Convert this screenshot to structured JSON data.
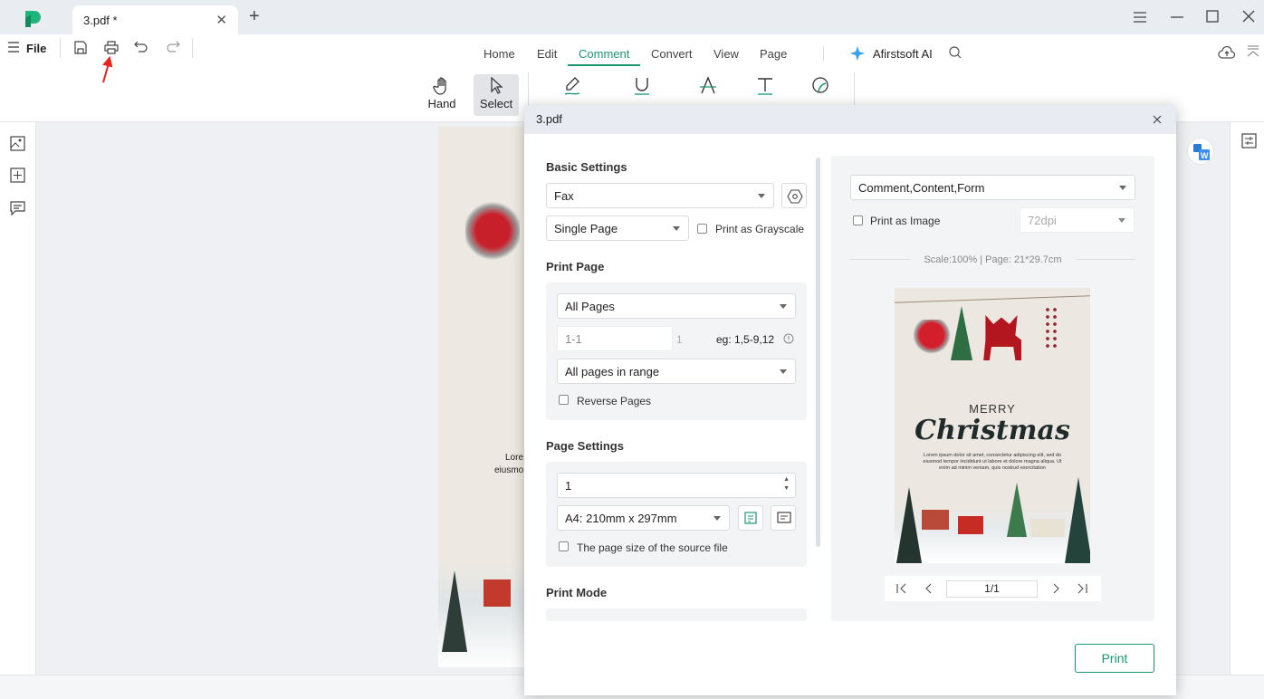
{
  "app": {
    "tab_title": "3.pdf *",
    "file_label": "File"
  },
  "menu": {
    "tabs": [
      "Home",
      "Edit",
      "Comment",
      "Convert",
      "View",
      "Page"
    ],
    "active": "Comment",
    "ai_label": "Afirstsoft AI"
  },
  "tools": [
    {
      "label": "Hand",
      "icon": "hand-icon"
    },
    {
      "label": "Select",
      "icon": "cursor-icon"
    }
  ],
  "colors": {
    "accent": "#1a9a6c",
    "annotation_arrow": "#e8231b"
  },
  "document": {
    "text_fragments": [
      "Lore",
      "eiusmo"
    ]
  },
  "dialog": {
    "title": "3.pdf",
    "basic_settings": {
      "heading": "Basic Settings",
      "printer": "Fax",
      "layout": "Single Page",
      "grayscale_label": "Print as Grayscale",
      "grayscale_checked": false
    },
    "print_page": {
      "heading": "Print Page",
      "range_mode": "All Pages",
      "range_placeholder": "1-1",
      "total": "1",
      "example": "eg: 1,5-9,12",
      "subset": "All pages in range",
      "reverse_label": "Reverse Pages",
      "reverse_checked": false
    },
    "page_settings": {
      "heading": "Page Settings",
      "copies": "1",
      "paper": "A4: 210mm x 297mm",
      "source_size_label": "The page size of the source file",
      "source_size_checked": false
    },
    "print_mode": {
      "heading": "Print Mode"
    },
    "preview": {
      "content": "Comment,Content,Form",
      "image_label": "Print as Image",
      "image_checked": false,
      "dpi": "72dpi",
      "info": "Scale:100% | Page: 21*29.7cm",
      "page_value": "1/1",
      "card": {
        "line1": "MERRY",
        "line2": "Christmas",
        "body": "Lorem ipsum dolor sit amet, consectetur adipiscing elit, sed do eiusmod tempor incididunt ut labore et dolore magna aliqua. Ut enim ad minim veniam, quis nostrud exercitation"
      }
    },
    "print_label": "Print"
  }
}
